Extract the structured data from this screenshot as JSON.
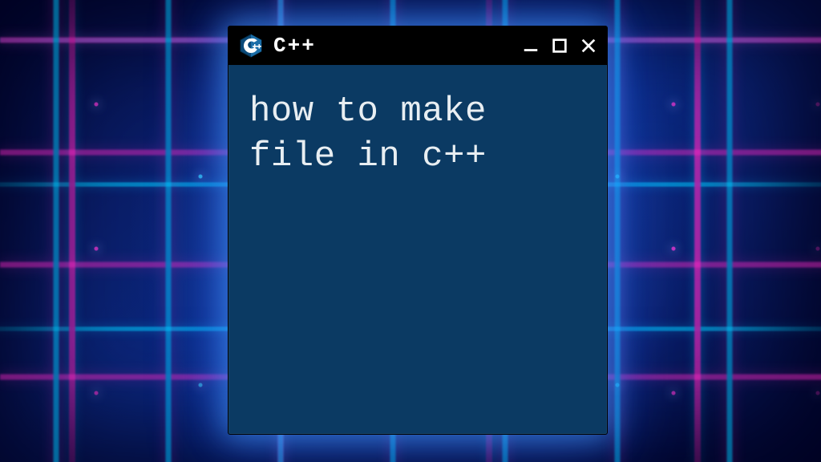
{
  "window": {
    "title": "C++",
    "icon_name": "cpp-logo-icon",
    "controls": {
      "minimize": "minimize",
      "maximize": "maximize",
      "close": "close"
    }
  },
  "content": {
    "text": "how to make\nfile in c++"
  },
  "colors": {
    "window_bg": "#0b3a63",
    "titlebar_bg": "#000000",
    "text": "#e8eef2",
    "glow_cyan": "#3cdcff",
    "glow_magenta": "#ff3cdc"
  }
}
